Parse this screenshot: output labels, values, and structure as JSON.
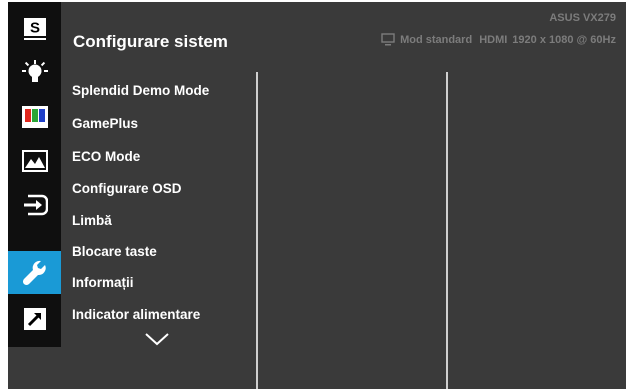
{
  "header": {
    "title": "Configurare sistem",
    "model": "ASUS VX279",
    "status": {
      "mode": "Mod standard",
      "input": "HDMI",
      "resolution": "1920 x 1080 @ 60Hz"
    }
  },
  "sidebar": {
    "items": [
      {
        "icon": "splendid-s-icon"
      },
      {
        "icon": "brightness-icon"
      },
      {
        "icon": "color-bars-icon"
      },
      {
        "icon": "image-icon"
      },
      {
        "icon": "input-select-icon"
      },
      {
        "icon": "wrench-icon",
        "active": true
      },
      {
        "icon": "shortcut-arrow-icon"
      }
    ]
  },
  "menu": {
    "items": [
      {
        "label": "Splendid Demo Mode"
      },
      {
        "label": "GamePlus"
      },
      {
        "label": "ECO Mode"
      },
      {
        "label": "Configurare OSD"
      },
      {
        "label": "Limbă"
      },
      {
        "label": "Blocare taste"
      },
      {
        "label": "Informații"
      },
      {
        "label": "Indicator alimentare"
      }
    ],
    "more_icon": "chevron-down-icon"
  },
  "colors": {
    "panel": "#3a3a3a",
    "sidebar": "#0f0f0f",
    "accent": "#1a9ad6",
    "status_text": "#7c7c7c"
  }
}
